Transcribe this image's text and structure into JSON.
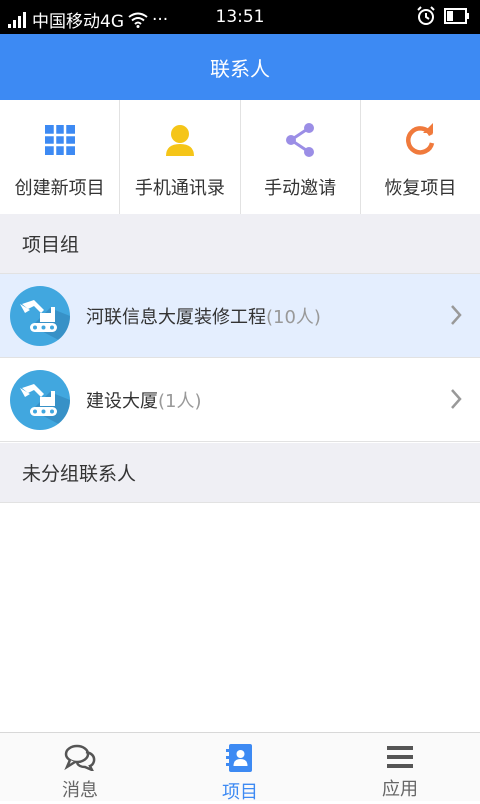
{
  "status_bar": {
    "carrier": "中国移动4G",
    "dots": "···",
    "time": "13:51"
  },
  "header": {
    "title": "联系人"
  },
  "actions": [
    {
      "label": "创建新项目",
      "icon": "grid-icon",
      "color": "#3d8af3"
    },
    {
      "label": "手机通讯录",
      "icon": "person-icon",
      "color": "#f5c518"
    },
    {
      "label": "手动邀请",
      "icon": "share-icon",
      "color": "#9b8ee6"
    },
    {
      "label": "恢复项目",
      "icon": "refresh-icon",
      "color": "#f07a3c"
    }
  ],
  "sections": {
    "project_group": "项目组",
    "ungrouped": "未分组联系人"
  },
  "projects": [
    {
      "name": "河联信息大厦装修工程",
      "count": "(10人)",
      "selected": true
    },
    {
      "name": "建设大厦",
      "count": "(1人)",
      "selected": false
    }
  ],
  "bottom_nav": [
    {
      "label": "消息",
      "icon": "chat-icon"
    },
    {
      "label": "项目",
      "icon": "contacts-book-icon",
      "active": true
    },
    {
      "label": "应用",
      "icon": "menu-icon"
    }
  ],
  "colors": {
    "accent": "#3d8af3",
    "selected_row": "#e4eefe",
    "section_bg": "#efeff4"
  }
}
